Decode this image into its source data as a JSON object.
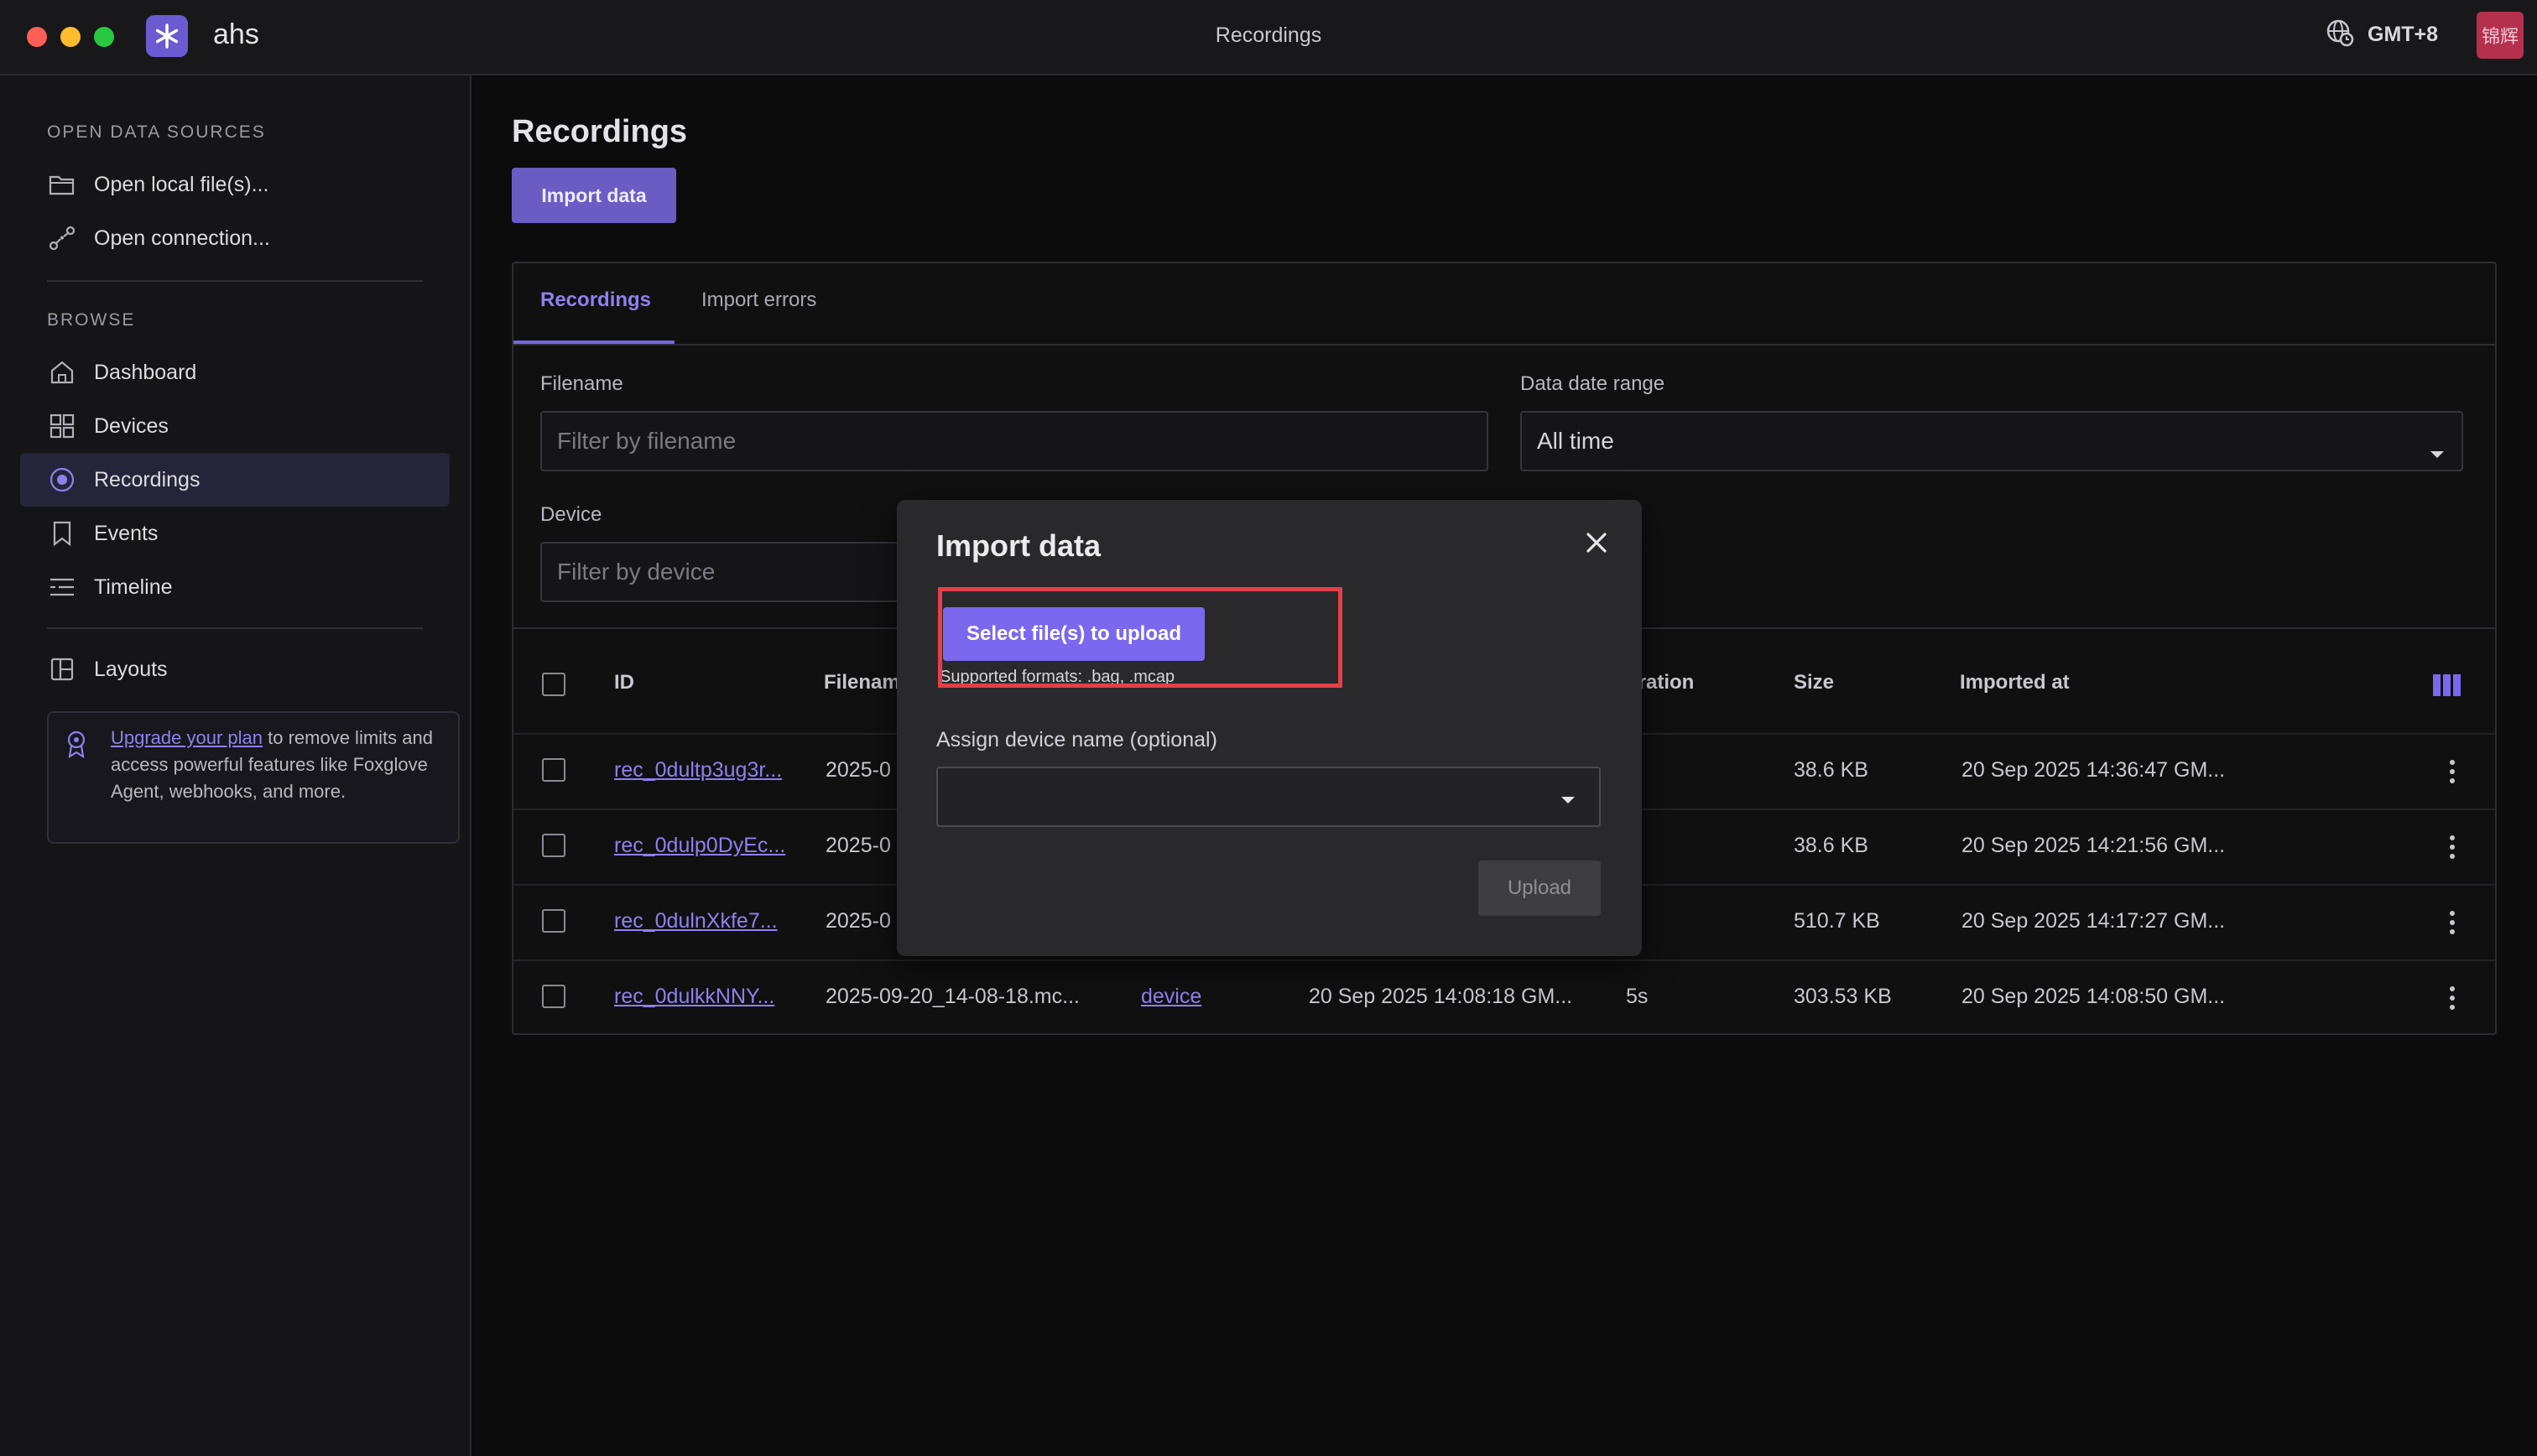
{
  "window": {
    "title": "Recordings",
    "app_name": "ahs",
    "timezone": "GMT+8",
    "user_avatar": "锦辉"
  },
  "sidebar": {
    "open_sources_title": "OPEN DATA SOURCES",
    "open_items": [
      {
        "label": "Open local file(s)...",
        "icon": "folder-icon"
      },
      {
        "label": "Open connection...",
        "icon": "connection-icon"
      }
    ],
    "browse_title": "BROWSE",
    "browse_items": [
      {
        "label": "Dashboard",
        "icon": "home-icon"
      },
      {
        "label": "Devices",
        "icon": "grid-icon"
      },
      {
        "label": "Recordings",
        "icon": "record-icon",
        "active": true
      },
      {
        "label": "Events",
        "icon": "bookmark-icon"
      },
      {
        "label": "Timeline",
        "icon": "timeline-icon"
      }
    ],
    "layouts_label": "Layouts",
    "upgrade": {
      "link": "Upgrade your plan",
      "text": " to remove limits and access powerful features like Foxglove Agent, webhooks, and more."
    }
  },
  "main": {
    "title": "Recordings",
    "import_button": "Import data",
    "tabs": [
      "Recordings",
      "Import errors"
    ],
    "filters": {
      "filename_label": "Filename",
      "filename_placeholder": "Filter by filename",
      "date_label": "Data date range",
      "date_value": "All time",
      "device_label": "Device",
      "device_placeholder": "Filter by device"
    },
    "columns": {
      "id": "ID",
      "filename": "Filenam",
      "duration": "uration",
      "size": "Size",
      "imported_at": "Imported at"
    },
    "rows": [
      {
        "id": "rec_0dultp3ug3r...",
        "filename": "2025-0",
        "device": "",
        "start": "",
        "duration": "s",
        "size": "38.6 KB",
        "imported_at": "20 Sep 2025 14:36:47 GM..."
      },
      {
        "id": "rec_0dulp0DyEc...",
        "filename": "2025-0",
        "device": "",
        "start": "",
        "duration": "s",
        "size": "38.6 KB",
        "imported_at": "20 Sep 2025 14:21:56 GM..."
      },
      {
        "id": "rec_0dulnXkfe7...",
        "filename": "2025-0",
        "device": "",
        "start": "",
        "duration": "s",
        "size": "510.7 KB",
        "imported_at": "20 Sep 2025 14:17:27 GM..."
      },
      {
        "id": "rec_0dulkkNNY...",
        "filename": "2025-09-20_14-08-18.mc...",
        "device": "device",
        "start": "20 Sep 2025 14:08:18 GM...",
        "duration": "5s",
        "size": "303.53 KB",
        "imported_at": "20 Sep 2025 14:08:50 GM..."
      }
    ]
  },
  "modal": {
    "title": "Import data",
    "select_button": "Select file(s) to upload",
    "formats": "Supported formats: .bag, .mcap",
    "assign_label": "Assign device name (optional)",
    "assign_value": "",
    "upload_button": "Upload"
  },
  "colors": {
    "accent": "#7b68ee",
    "highlight": "#e3404a",
    "background": "#0c0c0d"
  }
}
